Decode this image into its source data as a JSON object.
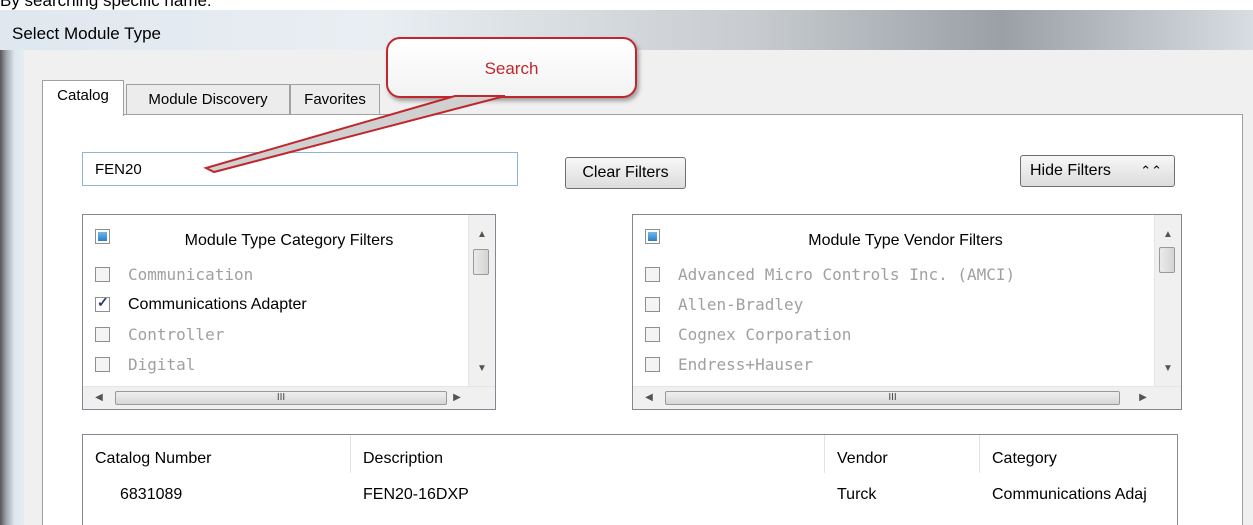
{
  "caption": "By searching specific name:",
  "window": {
    "title": "Select Module Type"
  },
  "tabs": [
    {
      "label": "Catalog",
      "active": true
    },
    {
      "label": "Module Discovery",
      "active": false
    },
    {
      "label": "Favorites",
      "active": false
    }
  ],
  "callout": {
    "text": "Search"
  },
  "search": {
    "value": "FEN20"
  },
  "buttons": {
    "clear_filters": "Clear Filters",
    "hide_filters": "Hide Filters",
    "hide_filters_icon": "double-chevron-up-icon"
  },
  "category_filters": {
    "header": "Module Type Category Filters",
    "items": [
      {
        "label": "Communication",
        "checked": false,
        "enabled": false
      },
      {
        "label": "Communications Adapter",
        "checked": true,
        "enabled": true
      },
      {
        "label": "Controller",
        "checked": false,
        "enabled": false
      },
      {
        "label": "Digital",
        "checked": false,
        "enabled": false
      }
    ]
  },
  "vendor_filters": {
    "header": "Module Type Vendor Filters",
    "items": [
      {
        "label": "Advanced Micro Controls Inc. (AMCI)",
        "checked": false,
        "enabled": false
      },
      {
        "label": "Allen-Bradley",
        "checked": false,
        "enabled": false
      },
      {
        "label": "Cognex Corporation",
        "checked": false,
        "enabled": false
      },
      {
        "label": "Endress+Hauser",
        "checked": false,
        "enabled": false
      }
    ]
  },
  "scroll_thumb_grip": "III",
  "results": {
    "columns": [
      "Catalog Number",
      "Description",
      "Vendor",
      "Category"
    ],
    "rows": [
      [
        "6831089",
        "FEN20-16DXP",
        "Turck",
        "Communications Adaj"
      ]
    ]
  },
  "colors": {
    "callout_red": "#c0272d",
    "header_checkbox_blue": "#2a7fc8"
  }
}
